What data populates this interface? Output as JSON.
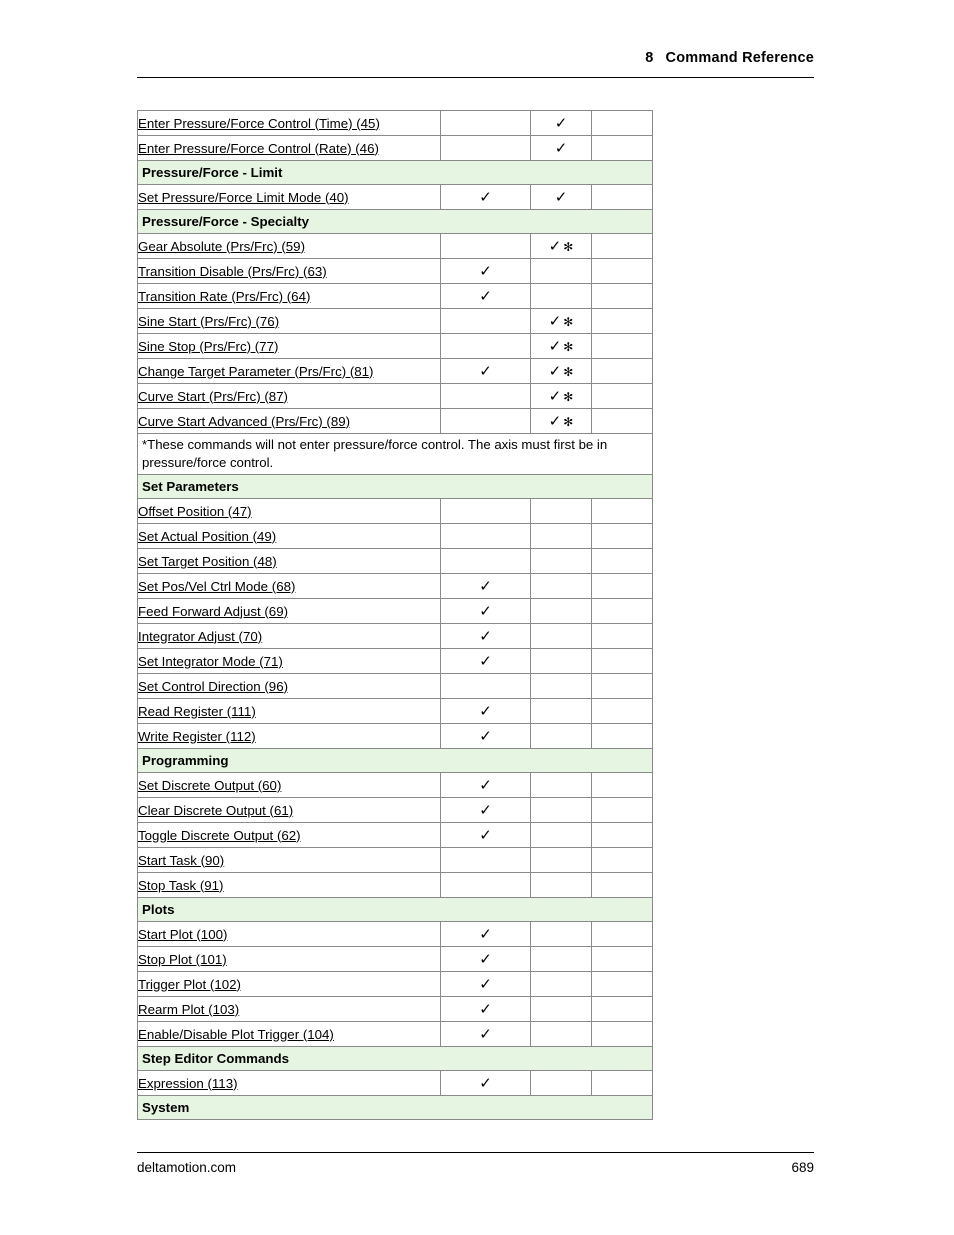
{
  "header": {
    "chapter_number": "8",
    "chapter_title": "Command Reference"
  },
  "footer": {
    "site": "deltamotion.com",
    "page_number": "689"
  },
  "table": {
    "rows": [
      {
        "type": "command",
        "label": "Enter Pressure/Force Control (Time) (45)",
        "c1": "",
        "c2": "check",
        "c3": ""
      },
      {
        "type": "command",
        "label": "Enter Pressure/Force Control (Rate) (46)",
        "c1": "",
        "c2": "check",
        "c3": ""
      },
      {
        "type": "section",
        "label": "Pressure/Force - Limit"
      },
      {
        "type": "command",
        "label": "Set Pressure/Force Limit Mode (40)",
        "c1": "check",
        "c2": "check",
        "c3": ""
      },
      {
        "type": "section",
        "label": "Pressure/Force - Specialty"
      },
      {
        "type": "command",
        "label": "Gear Absolute (Prs/Frc) (59)",
        "c1": "",
        "c2": "check-star",
        "c3": ""
      },
      {
        "type": "command",
        "label": "Transition Disable (Prs/Frc) (63)",
        "c1": "check",
        "c2": "",
        "c3": ""
      },
      {
        "type": "command",
        "label": "Transition Rate (Prs/Frc) (64)",
        "c1": "check",
        "c2": "",
        "c3": ""
      },
      {
        "type": "command",
        "label": "Sine Start (Prs/Frc) (76)",
        "c1": "",
        "c2": "check-star",
        "c3": ""
      },
      {
        "type": "command",
        "label": "Sine Stop (Prs/Frc) (77)",
        "c1": "",
        "c2": "check-star",
        "c3": ""
      },
      {
        "type": "command",
        "label": "Change Target Parameter (Prs/Frc) (81)",
        "c1": "check",
        "c2": "check-star",
        "c3": ""
      },
      {
        "type": "command",
        "label": "Curve Start (Prs/Frc) (87)",
        "c1": "",
        "c2": "check-star",
        "c3": ""
      },
      {
        "type": "command",
        "label": "Curve Start Advanced (Prs/Frc) (89)",
        "c1": "",
        "c2": "check-star",
        "c3": ""
      },
      {
        "type": "note",
        "label": "*These commands will not enter pressure/force control. The axis must first be in pressure/force control."
      },
      {
        "type": "section",
        "label": "Set Parameters"
      },
      {
        "type": "command",
        "label": "Offset Position (47)",
        "c1": "",
        "c2": "",
        "c3": ""
      },
      {
        "type": "command",
        "label": "Set Actual Position (49)",
        "c1": "",
        "c2": "",
        "c3": ""
      },
      {
        "type": "command",
        "label": "Set Target Position (48)",
        "c1": "",
        "c2": "",
        "c3": ""
      },
      {
        "type": "command",
        "label": "Set Pos/Vel Ctrl Mode (68)",
        "c1": "check",
        "c2": "",
        "c3": ""
      },
      {
        "type": "command",
        "label": "Feed Forward Adjust (69)",
        "c1": "check",
        "c2": "",
        "c3": ""
      },
      {
        "type": "command",
        "label": "Integrator Adjust (70)",
        "c1": "check",
        "c2": "",
        "c3": ""
      },
      {
        "type": "command",
        "label": "Set Integrator Mode (71)",
        "c1": "check",
        "c2": "",
        "c3": ""
      },
      {
        "type": "command",
        "label": "Set Control Direction (96)",
        "c1": "",
        "c2": "",
        "c3": ""
      },
      {
        "type": "command",
        "label": "Read Register (111)",
        "c1": "check",
        "c2": "",
        "c3": ""
      },
      {
        "type": "command",
        "label": "Write Register (112)",
        "c1": "check",
        "c2": "",
        "c3": ""
      },
      {
        "type": "section",
        "label": "Programming"
      },
      {
        "type": "command",
        "label": "Set Discrete Output (60)",
        "c1": "check",
        "c2": "",
        "c3": ""
      },
      {
        "type": "command",
        "label": "Clear Discrete Output (61)",
        "c1": "check",
        "c2": "",
        "c3": ""
      },
      {
        "type": "command",
        "label": "Toggle Discrete Output (62)",
        "c1": "check",
        "c2": "",
        "c3": ""
      },
      {
        "type": "command",
        "label": "Start Task (90)",
        "c1": "",
        "c2": "",
        "c3": ""
      },
      {
        "type": "command",
        "label": "Stop Task (91)",
        "c1": "",
        "c2": "",
        "c3": ""
      },
      {
        "type": "section",
        "label": "Plots"
      },
      {
        "type": "command",
        "label": "Start Plot (100)",
        "c1": "check",
        "c2": "",
        "c3": ""
      },
      {
        "type": "command",
        "label": "Stop Plot (101)",
        "c1": "check",
        "c2": "",
        "c3": ""
      },
      {
        "type": "command",
        "label": "Trigger Plot (102)",
        "c1": "check",
        "c2": "",
        "c3": ""
      },
      {
        "type": "command",
        "label": "Rearm Plot (103)",
        "c1": "check",
        "c2": "",
        "c3": ""
      },
      {
        "type": "command",
        "label": "Enable/Disable Plot Trigger (104)",
        "c1": "check",
        "c2": "",
        "c3": ""
      },
      {
        "type": "section",
        "label": "Step Editor Commands"
      },
      {
        "type": "command",
        "label": "Expression (113)",
        "c1": "check",
        "c2": "",
        "c3": ""
      },
      {
        "type": "section",
        "label": "System"
      }
    ],
    "check_glyph": "✓",
    "star_glyph": "✻"
  },
  "colors": {
    "section_background": "#e6f5e1",
    "border": "#8a8a8a",
    "text": "#000000"
  }
}
